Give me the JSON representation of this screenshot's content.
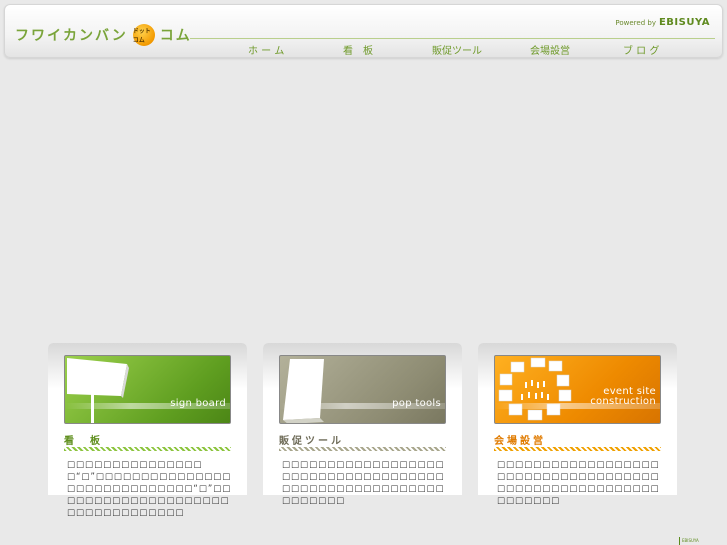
{
  "header": {
    "logo_text_left": "フワイカンバン",
    "logo_badge": "ドットコム",
    "logo_text_right": "コム",
    "powered_by": "Powered by",
    "powered_brand": "EBISUYA"
  },
  "nav": [
    {
      "label": "ホ ー ム"
    },
    {
      "label": "看　板"
    },
    {
      "label": "販促ツール"
    },
    {
      "label": "会場設営"
    },
    {
      "label": "ブ ロ グ"
    }
  ],
  "cards": [
    {
      "banner_label": "sign board",
      "title": "看　板",
      "description": "□□□□□□□□□□□□□□□□“□”□□□□□□□□□□□□□□□□□□□□□□□□□□□□□“□”□□□□□□□□□□□□□□□□□□□□□□□□□□□□□□□□□"
    },
    {
      "banner_label": "pop tools",
      "title": "販促ツール",
      "description": "□□□□□□□□□□□□□□□□□□□□□□□□□□□□□□□□□□□□□□□□□□□□□□□□□□□□□□□□□□□□□"
    },
    {
      "banner_label": "event site construction",
      "title": "会場設営",
      "description": "□□□□□□□□□□□□□□□□□□□□□□□□□□□□□□□□□□□□□□□□□□□□□□□□□□□□□□□□□□□□□"
    }
  ],
  "footer": {
    "corner_label": "EBISUYA"
  },
  "colors": {
    "accent_green": "#6f9a2a",
    "accent_olive": "#8e8c73",
    "accent_orange": "#ee8a00"
  }
}
